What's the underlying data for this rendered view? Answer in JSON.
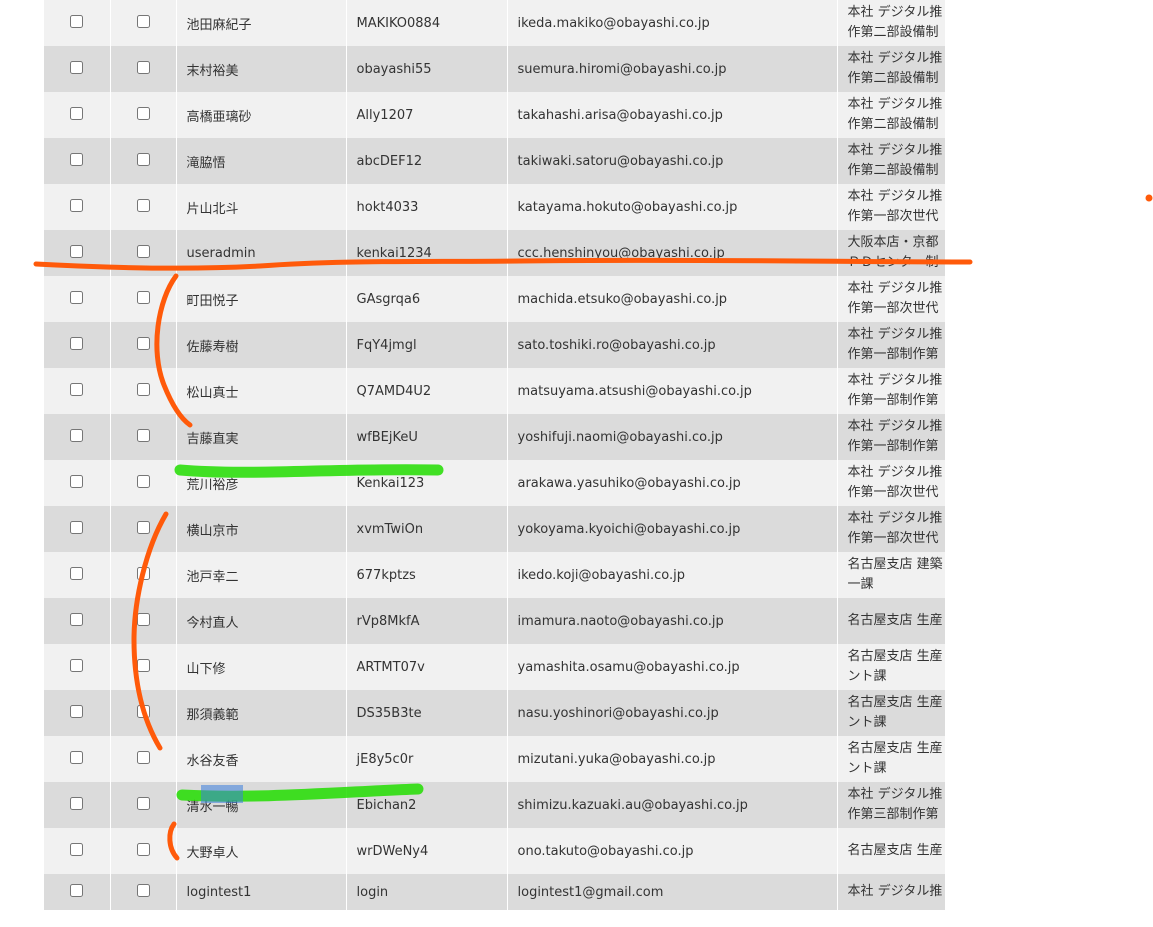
{
  "table": {
    "rows": [
      {
        "name": "池田麻紀子",
        "login_id": "MAKIKO0884",
        "email": "ikeda.makiko@obayashi.co.jp",
        "dept_line1": "本社 デジタル推",
        "dept_line2": "作第二部設備制"
      },
      {
        "name": "末村裕美",
        "login_id": "obayashi55",
        "email": "suemura.hiromi@obayashi.co.jp",
        "dept_line1": "本社 デジタル推",
        "dept_line2": "作第二部設備制"
      },
      {
        "name": "高橋亜璃砂",
        "login_id": "Ally1207",
        "email": "takahashi.arisa@obayashi.co.jp",
        "dept_line1": "本社 デジタル推",
        "dept_line2": "作第二部設備制"
      },
      {
        "name": "滝脇悟",
        "login_id": "abcDEF12",
        "email": "takiwaki.satoru@obayashi.co.jp",
        "dept_line1": "本社 デジタル推",
        "dept_line2": "作第二部設備制"
      },
      {
        "name": "片山北斗",
        "login_id": "hokt4033",
        "email": "katayama.hokuto@obayashi.co.jp",
        "dept_line1": "本社 デジタル推",
        "dept_line2": "作第一部次世代"
      },
      {
        "name": "useradmin",
        "login_id": "kenkai1234",
        "email": "ccc.henshinyou@obayashi.co.jp",
        "dept_line1": "大阪本店・京都",
        "dept_line2": "ＰＤセンター制"
      },
      {
        "name": "町田悦子",
        "login_id": "GAsgrqa6",
        "email": "machida.etsuko@obayashi.co.jp",
        "dept_line1": "本社 デジタル推",
        "dept_line2": "作第一部次世代"
      },
      {
        "name": "佐藤寿樹",
        "login_id": "FqY4jmgl",
        "email": "sato.toshiki.ro@obayashi.co.jp",
        "dept_line1": "本社 デジタル推",
        "dept_line2": "作第一部制作第"
      },
      {
        "name": "松山真士",
        "login_id": "Q7AMD4U2",
        "email": "matsuyama.atsushi@obayashi.co.jp",
        "dept_line1": "本社 デジタル推",
        "dept_line2": "作第一部制作第"
      },
      {
        "name": "吉藤直実",
        "login_id": "wfBEjKeU",
        "email": "yoshifuji.naomi@obayashi.co.jp",
        "dept_line1": "本社 デジタル推",
        "dept_line2": "作第一部制作第"
      },
      {
        "name": "荒川裕彦",
        "login_id": "Kenkai123",
        "email": "arakawa.yasuhiko@obayashi.co.jp",
        "dept_line1": "本社 デジタル推",
        "dept_line2": "作第一部次世代"
      },
      {
        "name": "横山京市",
        "login_id": "xvmTwiOn",
        "email": "yokoyama.kyoichi@obayashi.co.jp",
        "dept_line1": "本社 デジタル推",
        "dept_line2": "作第一部次世代"
      },
      {
        "name": "池戸幸二",
        "login_id": "677kptzs",
        "email": "ikedo.koji@obayashi.co.jp",
        "dept_line1": "名古屋支店 建築",
        "dept_line2": "一課"
      },
      {
        "name": "今村直人",
        "login_id": "rVp8MkfA",
        "email": "imamura.naoto@obayashi.co.jp",
        "dept_line1": "名古屋支店 生産",
        "dept_line2": ""
      },
      {
        "name": "山下修",
        "login_id": "ARTMT07v",
        "email": "yamashita.osamu@obayashi.co.jp",
        "dept_line1": "名古屋支店 生産",
        "dept_line2": "ント課"
      },
      {
        "name": "那須義範",
        "login_id": "DS35B3te",
        "email": "nasu.yoshinori@obayashi.co.jp",
        "dept_line1": "名古屋支店 生産",
        "dept_line2": "ント課"
      },
      {
        "name": "水谷友香",
        "login_id": "jE8y5c0r",
        "email": "mizutani.yuka@obayashi.co.jp",
        "dept_line1": "名古屋支店 生産",
        "dept_line2": "ント課"
      },
      {
        "name": "清水一暢",
        "login_id": "Ebichan2",
        "email": "shimizu.kazuaki.au@obayashi.co.jp",
        "dept_line1": "本社 デジタル推",
        "dept_line2": "作第三部制作第"
      },
      {
        "name": "大野卓人",
        "login_id": "wrDWeNy4",
        "email": "ono.takuto@obayashi.co.jp",
        "dept_line1": "名古屋支店 生産",
        "dept_line2": ""
      },
      {
        "name": "logintest1",
        "login_id": "login",
        "email": "logintest1@gmail.com",
        "dept_line1": "本社 デジタル推",
        "dept_line2": ""
      }
    ]
  },
  "colors": {
    "row_odd": "#f1f1f1",
    "row_even": "#dbdbdb",
    "annotation_orange": "#ff5a0a",
    "annotation_green": "#22dd00"
  }
}
